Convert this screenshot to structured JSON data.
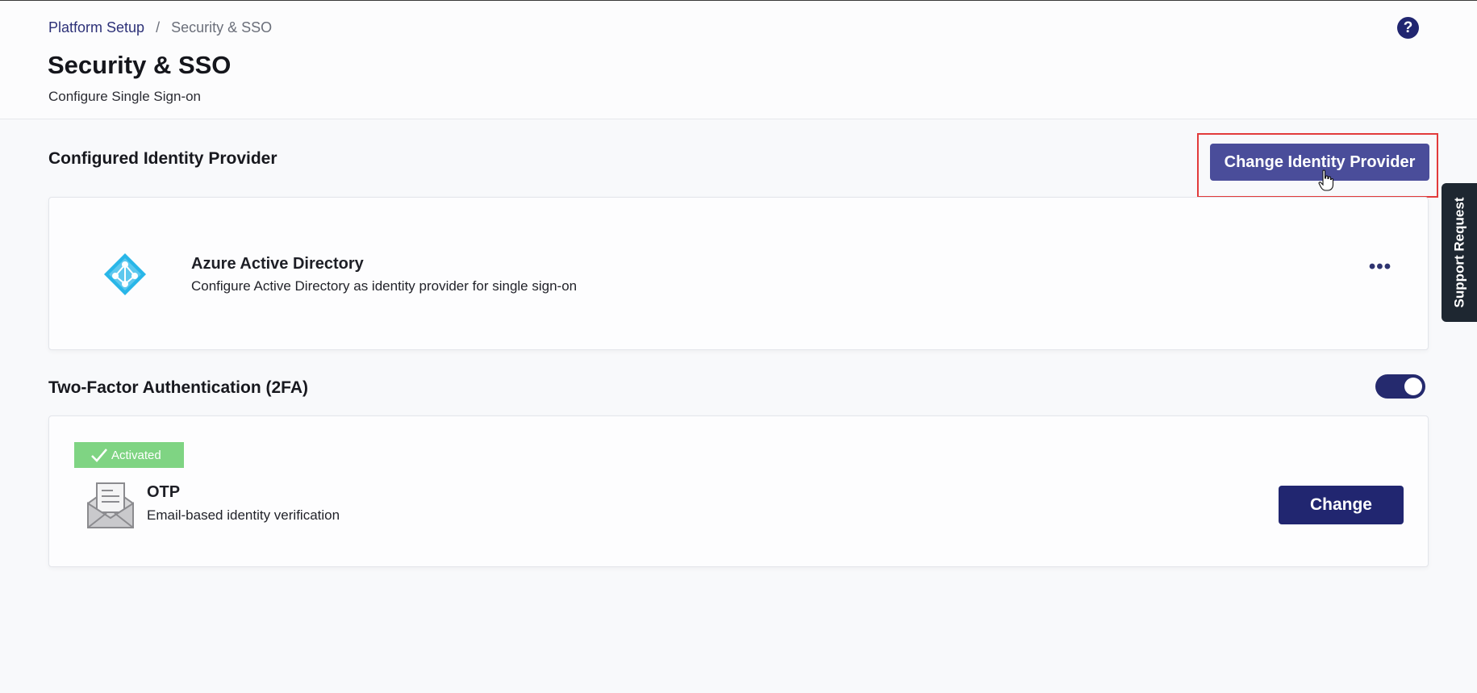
{
  "breadcrumb": {
    "parent": "Platform Setup",
    "separator": "/",
    "current": "Security & SSO"
  },
  "header": {
    "title": "Security & SSO",
    "subtitle": "Configure Single Sign-on",
    "help_label": "?"
  },
  "identity_provider": {
    "section_title": "Configured Identity Provider",
    "change_button_label": "Change Identity Provider",
    "provider_name": "Azure Active Directory",
    "provider_description": "Configure Active Directory as identity provider for single sign-on",
    "more_label": "•••"
  },
  "two_factor": {
    "section_title": "Two-Factor Authentication (2FA)",
    "enabled": true,
    "badge_label": "Activated",
    "method_name": "OTP",
    "method_description": "Email-based identity verification",
    "change_button_label": "Change"
  },
  "support": {
    "label": "Support Request"
  },
  "colors": {
    "primary": "#212670",
    "primary_hover": "#4a4d9a",
    "azure": "#29b6e8",
    "activated": "#7fd483",
    "highlight": "#e23b3b",
    "support_tab": "#1e2731"
  }
}
